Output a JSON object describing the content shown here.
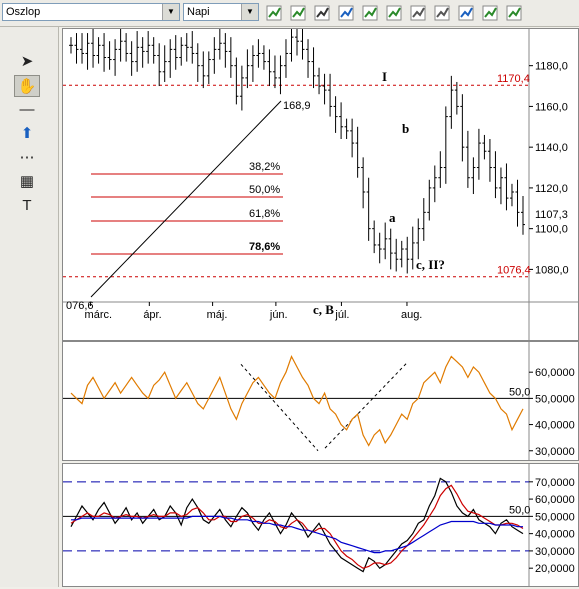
{
  "toolbar": {
    "chart_type": "Oszlop",
    "period": "Napi",
    "icons": [
      "dollar-icon",
      "refresh-green-icon",
      "crosshair-icon",
      "trend-up-icon",
      "chart-edit-icon",
      "chart-pen-icon",
      "chart-line-icon",
      "printer-icon",
      "refresh-blue-icon",
      "zoom-icon",
      "download-icon"
    ]
  },
  "sidebar": {
    "tools": [
      {
        "name": "pointer-icon",
        "glyph": "➤"
      },
      {
        "name": "hand-icon",
        "glyph": "✋"
      },
      {
        "name": "line-icon",
        "glyph": "—"
      },
      {
        "name": "arrow-up-icon",
        "glyph": "⬆"
      },
      {
        "name": "dotted-lines-icon",
        "glyph": "⋯"
      },
      {
        "name": "calculator-icon",
        "glyph": "▦"
      },
      {
        "name": "text-icon",
        "glyph": "T"
      }
    ]
  },
  "colors": {
    "price": "#000000",
    "rsi": "#e07b00",
    "stoch_k": "#cc0000",
    "stoch_d": "#0000cc",
    "level": "#cc0000",
    "dashed": "#0000aa"
  },
  "chart_data": [
    {
      "type": "bar",
      "title": "",
      "ylim": [
        1064,
        1198
      ],
      "y_ticks": [
        "1180,0",
        "1160,0",
        "1140,0",
        "1120,0",
        "1100,0",
        "1080,0"
      ],
      "last_price": "1107,3",
      "months": [
        "márc.",
        "ápr.",
        "máj.",
        "jún.",
        "júl.",
        "aug."
      ],
      "levels": [
        {
          "label": "1170,4",
          "value": 1170.4
        },
        {
          "label": "1076,4",
          "value": 1076.4
        }
      ],
      "fib": [
        {
          "label": "38,2%"
        },
        {
          "label": "50,0%"
        },
        {
          "label": "61,8%"
        },
        {
          "label": "78,6%"
        }
      ],
      "annotations": {
        "start": "076,6",
        "peak": "168,9",
        "wave_I": "I",
        "wave_b": "b",
        "wave_a": "a",
        "wave_cB": "c, B",
        "wave_cII": "c, II?"
      },
      "closes": [
        1190,
        1188,
        1186,
        1191,
        1185,
        1190,
        1184,
        1183,
        1188,
        1192,
        1186,
        1182,
        1189,
        1187,
        1190,
        1185,
        1177,
        1182,
        1188,
        1184,
        1190,
        1189,
        1186,
        1180,
        1175,
        1183,
        1188,
        1191,
        1187,
        1180,
        1165,
        1174,
        1180,
        1185,
        1186,
        1182,
        1177,
        1174,
        1180,
        1186,
        1194,
        1192,
        1188,
        1182,
        1175,
        1170,
        1168,
        1160,
        1155,
        1150,
        1148,
        1142,
        1130,
        1118,
        1100,
        1092,
        1090,
        1095,
        1088,
        1085,
        1090,
        1085,
        1093,
        1100,
        1108,
        1120,
        1125,
        1130,
        1155,
        1168,
        1160,
        1140,
        1125,
        1130,
        1142,
        1138,
        1130,
        1120,
        1125,
        1115,
        1118,
        1108,
        1102
      ]
    },
    {
      "type": "line",
      "ylim": [
        28,
        70
      ],
      "y_ticks": [
        "60,0000",
        "50,0000",
        "40,0000",
        "30,0000"
      ],
      "level": "50,0",
      "series": [
        {
          "values": [
            52,
            50,
            48,
            55,
            58,
            54,
            50,
            53,
            56,
            52,
            55,
            58,
            55,
            52,
            50,
            55,
            57,
            60,
            55,
            50,
            53,
            56,
            52,
            48,
            46,
            50,
            54,
            58,
            52,
            46,
            42,
            48,
            52,
            56,
            58,
            55,
            52,
            50,
            56,
            60,
            66,
            62,
            58,
            55,
            50,
            48,
            52,
            46,
            44,
            40,
            38,
            42,
            44,
            36,
            32,
            36,
            38,
            33,
            36,
            40,
            44,
            42,
            48,
            50,
            56,
            58,
            60,
            56,
            62,
            66,
            64,
            62,
            58,
            62,
            60,
            56,
            52,
            50,
            46,
            44,
            38,
            42,
            46
          ]
        }
      ]
    },
    {
      "type": "line",
      "ylim": [
        12,
        78
      ],
      "y_ticks": [
        "70,0000",
        "60,0000",
        "50,0000",
        "40,0000",
        "30,0000",
        "20,0000"
      ],
      "level": "50,0",
      "series": [
        {
          "values": [
            44,
            50,
            56,
            52,
            48,
            54,
            58,
            52,
            46,
            50,
            55,
            48,
            52,
            46,
            50,
            54,
            48,
            50,
            56,
            52,
            45,
            55,
            60,
            55,
            48,
            46,
            50,
            54,
            48,
            44,
            50,
            55,
            52,
            46,
            42,
            48,
            52,
            46,
            40,
            45,
            52,
            48,
            44,
            38,
            42,
            46,
            40,
            34,
            30,
            26,
            24,
            22,
            20,
            18,
            26,
            24,
            20,
            22,
            26,
            30,
            34,
            36,
            40,
            46,
            48,
            56,
            62,
            72,
            70,
            64,
            56,
            52,
            50,
            54,
            48,
            46,
            44,
            40,
            46,
            48,
            44,
            42,
            40
          ]
        },
        {
          "values": [
            46,
            48,
            50,
            52,
            50,
            50,
            52,
            51,
            49,
            50,
            51,
            50,
            50,
            49,
            50,
            51,
            50,
            50,
            52,
            52,
            50,
            51,
            54,
            55,
            52,
            48,
            48,
            50,
            50,
            47,
            47,
            50,
            51,
            49,
            46,
            46,
            48,
            47,
            44,
            43,
            46,
            48,
            46,
            42,
            41,
            43,
            43,
            40,
            35,
            30,
            27,
            25,
            22,
            20,
            21,
            23,
            23,
            22,
            23,
            26,
            30,
            33,
            37,
            41,
            45,
            50,
            55,
            62,
            66,
            68,
            63,
            57,
            53,
            52,
            51,
            49,
            47,
            45,
            45,
            46,
            46,
            45,
            43
          ]
        },
        {
          "values": [
            48,
            48,
            49,
            49,
            49,
            49,
            49,
            49,
            49,
            49,
            49,
            49,
            49,
            49,
            49,
            49,
            49,
            49,
            49,
            49,
            49,
            49,
            50,
            50,
            50,
            50,
            50,
            50,
            49,
            49,
            48,
            48,
            48,
            47,
            47,
            46,
            46,
            45,
            45,
            44,
            44,
            43,
            42,
            42,
            41,
            40,
            39,
            38,
            37,
            35,
            34,
            33,
            32,
            31,
            30,
            29,
            29,
            30,
            30,
            31,
            32,
            33,
            35,
            37,
            39,
            41,
            43,
            45,
            46,
            47,
            47,
            47,
            47,
            47,
            46,
            46,
            46,
            45,
            45,
            45,
            45,
            44,
            44
          ]
        }
      ]
    }
  ]
}
